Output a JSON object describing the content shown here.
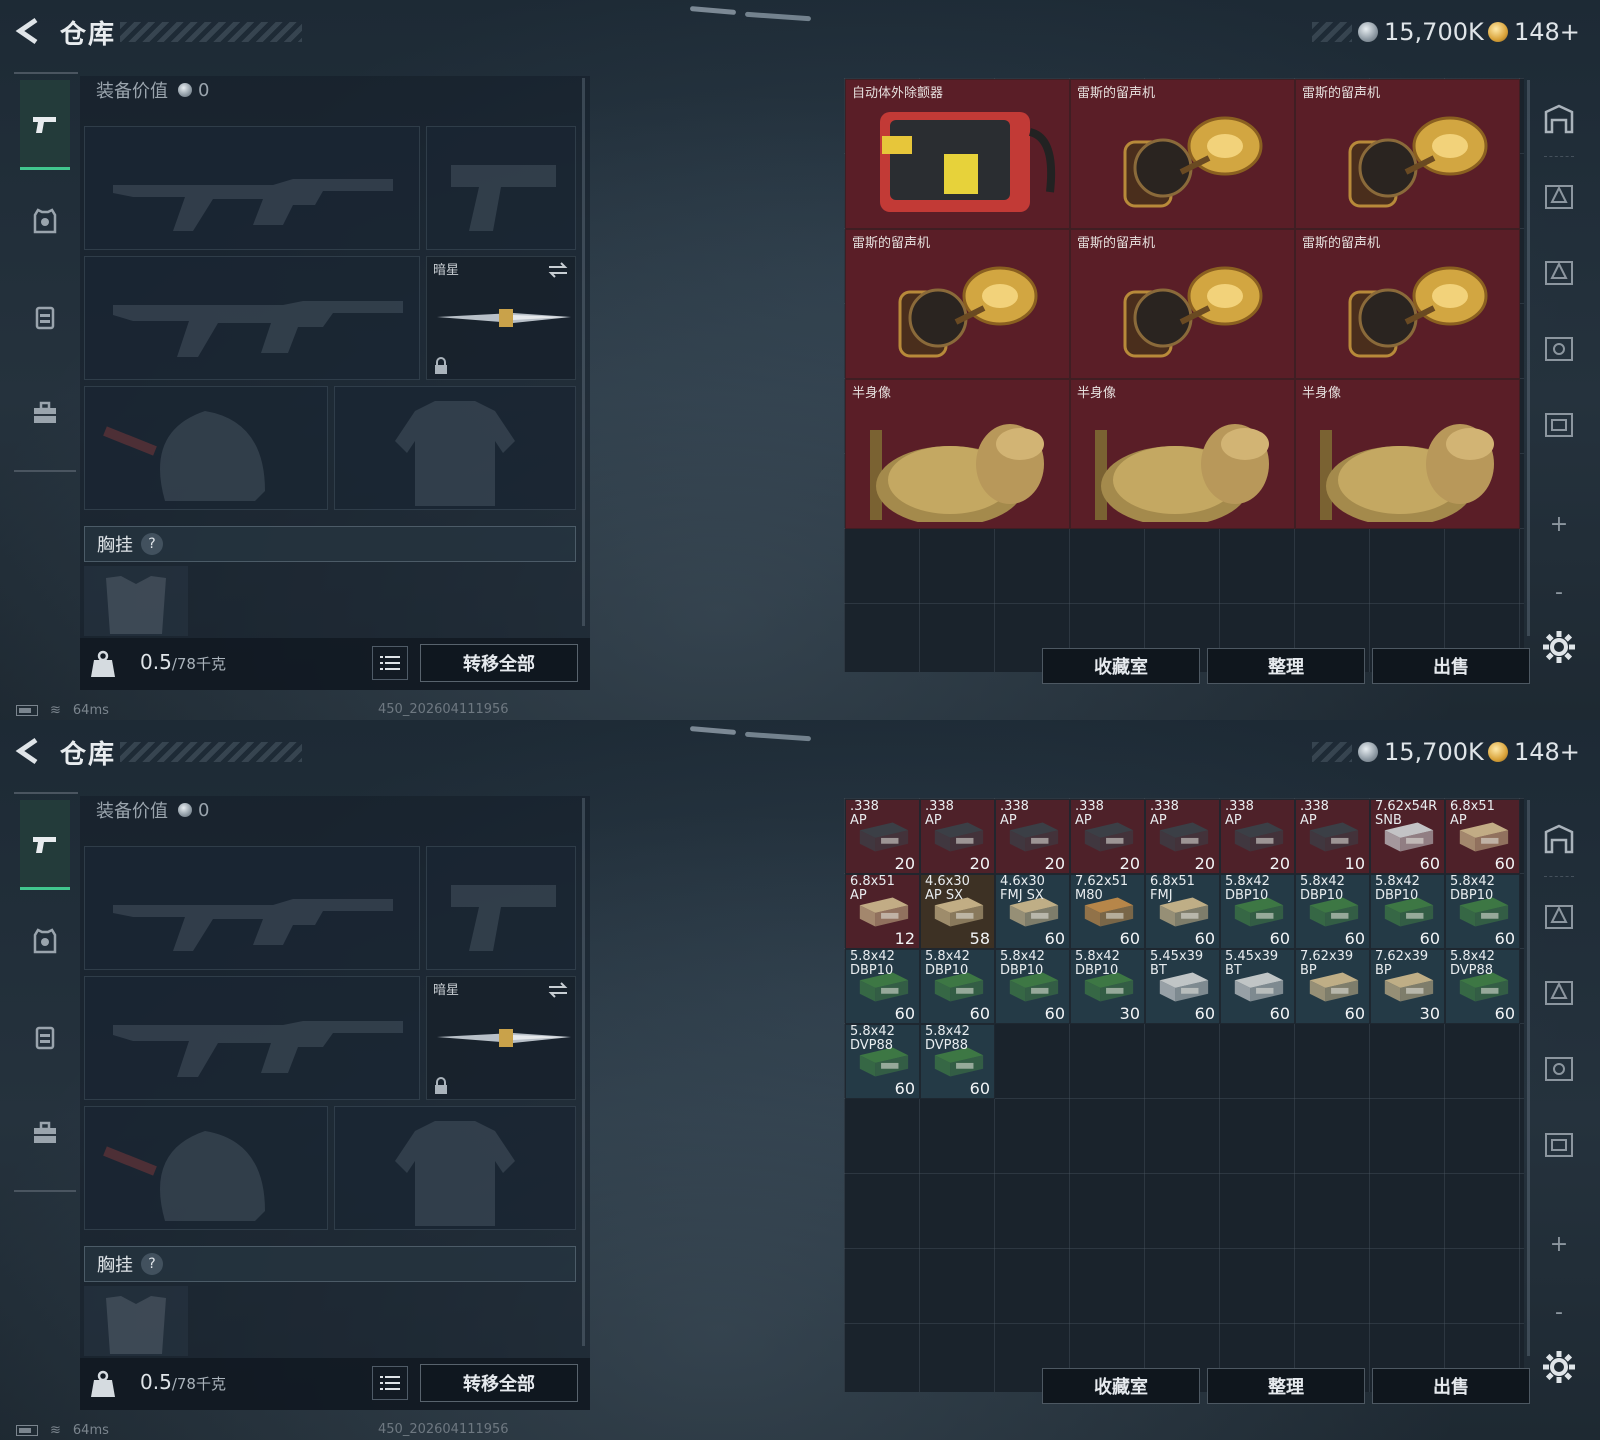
{
  "header": {
    "title": "仓库",
    "money": "15,700K",
    "gold": "148+"
  },
  "equipment": {
    "value_label": "装备价值",
    "value": "0",
    "melee_name": "暗星",
    "chest_rig_label": "胸挂",
    "help_symbol": "?",
    "weight_current": "0.5",
    "weight_max": "/78千克",
    "transfer_all_label": "转移全部"
  },
  "status": {
    "ping": "64ms",
    "build_id": "450_202604111956"
  },
  "actions": {
    "collection_label": "收藏室",
    "sort_label": "整理",
    "sell_label": "出售"
  },
  "toolbar": {
    "plus": "+",
    "minus": "-"
  },
  "stash_top": {
    "items": [
      {
        "name": "自动体外除颤器",
        "kind": "defibrillator"
      },
      {
        "name": "雷斯的留声机",
        "kind": "gramophone"
      },
      {
        "name": "雷斯的留声机",
        "kind": "gramophone"
      },
      {
        "name": "雷斯的留声机",
        "kind": "gramophone"
      },
      {
        "name": "雷斯的留声机",
        "kind": "gramophone"
      },
      {
        "name": "雷斯的留声机",
        "kind": "gramophone"
      },
      {
        "name": "半身像",
        "kind": "bust"
      },
      {
        "name": "半身像",
        "kind": "bust"
      },
      {
        "name": "半身像",
        "kind": "bust"
      }
    ]
  },
  "stash_bottom": {
    "ammo": [
      {
        "line1": ".338",
        "line2": "AP",
        "qty": "20",
        "color": "red",
        "box": "dark"
      },
      {
        "line1": ".338",
        "line2": "AP",
        "qty": "20",
        "color": "red",
        "box": "dark"
      },
      {
        "line1": ".338",
        "line2": "AP",
        "qty": "20",
        "color": "red",
        "box": "dark"
      },
      {
        "line1": ".338",
        "line2": "AP",
        "qty": "20",
        "color": "red",
        "box": "dark"
      },
      {
        "line1": ".338",
        "line2": "AP",
        "qty": "20",
        "color": "red",
        "box": "dark"
      },
      {
        "line1": ".338",
        "line2": "AP",
        "qty": "20",
        "color": "red",
        "box": "dark"
      },
      {
        "line1": ".338",
        "line2": "AP",
        "qty": "10",
        "color": "red",
        "box": "dark"
      },
      {
        "line1": "7.62x54R",
        "line2": "SNB",
        "qty": "60",
        "color": "red",
        "box": "white"
      },
      {
        "line1": "6.8x51",
        "line2": "AP",
        "qty": "60",
        "color": "red",
        "box": "tan"
      },
      {
        "line1": "6.8x51",
        "line2": "AP",
        "qty": "12",
        "color": "red",
        "box": "tan"
      },
      {
        "line1": "4.6x30",
        "line2": "AP SX",
        "qty": "58",
        "color": "brown",
        "box": "tan"
      },
      {
        "line1": "4.6x30",
        "line2": "FMJ SX",
        "qty": "60",
        "color": "teal",
        "box": "tan"
      },
      {
        "line1": "7.62x51",
        "line2": "M80",
        "qty": "60",
        "color": "teal",
        "box": "crate"
      },
      {
        "line1": "6.8x51",
        "line2": "FMJ",
        "qty": "60",
        "color": "teal",
        "box": "tan"
      },
      {
        "line1": "5.8x42",
        "line2": "DBP10",
        "qty": "60",
        "color": "teal",
        "box": "green"
      },
      {
        "line1": "5.8x42",
        "line2": "DBP10",
        "qty": "60",
        "color": "teal",
        "box": "green"
      },
      {
        "line1": "5.8x42",
        "line2": "DBP10",
        "qty": "60",
        "color": "teal",
        "box": "green"
      },
      {
        "line1": "5.8x42",
        "line2": "DBP10",
        "qty": "60",
        "color": "teal",
        "box": "green"
      },
      {
        "line1": "5.8x42",
        "line2": "DBP10",
        "qty": "60",
        "color": "teal",
        "box": "green"
      },
      {
        "line1": "5.8x42",
        "line2": "DBP10",
        "qty": "60",
        "color": "teal",
        "box": "green"
      },
      {
        "line1": "5.8x42",
        "line2": "DBP10",
        "qty": "60",
        "color": "teal",
        "box": "green"
      },
      {
        "line1": "5.8x42",
        "line2": "DBP10",
        "qty": "30",
        "color": "teal",
        "box": "green"
      },
      {
        "line1": "5.45x39",
        "line2": "BT",
        "qty": "60",
        "color": "teal",
        "box": "white"
      },
      {
        "line1": "5.45x39",
        "line2": "BT",
        "qty": "60",
        "color": "teal",
        "box": "white"
      },
      {
        "line1": "7.62x39",
        "line2": "BP",
        "qty": "60",
        "color": "teal",
        "box": "tan"
      },
      {
        "line1": "7.62x39",
        "line2": "BP",
        "qty": "30",
        "color": "teal",
        "box": "tan"
      },
      {
        "line1": "5.8x42",
        "line2": "DVP88",
        "qty": "60",
        "color": "teal",
        "box": "green"
      },
      {
        "line1": "5.8x42",
        "line2": "DVP88",
        "qty": "60",
        "color": "teal",
        "box": "green"
      },
      {
        "line1": "5.8x42",
        "line2": "DVP88",
        "qty": "60",
        "color": "teal",
        "box": "green"
      }
    ]
  },
  "colors": {
    "accent_green": "#41c78e",
    "rare_red": "#5a1e27"
  }
}
